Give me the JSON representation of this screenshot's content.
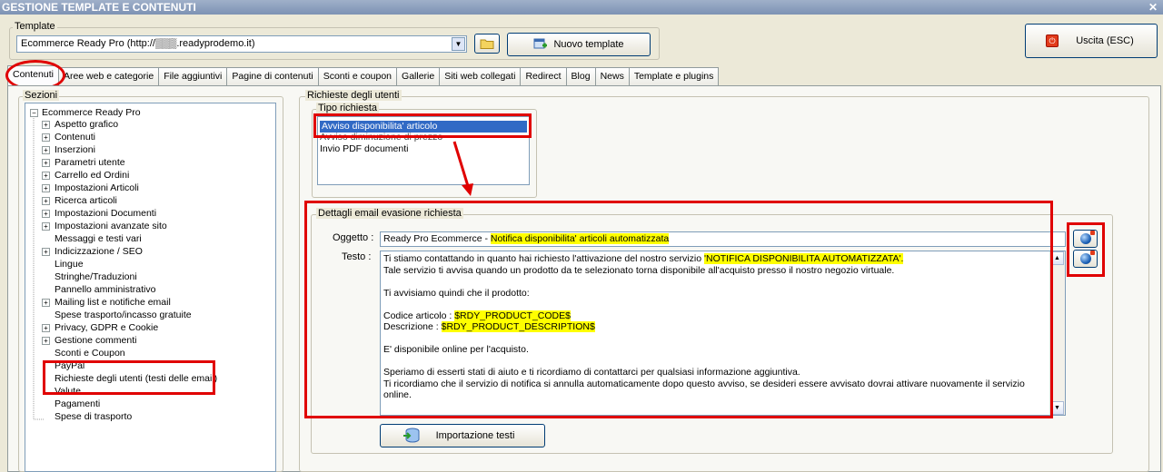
{
  "window": {
    "title": "GESTIONE TEMPLATE E CONTENUTI",
    "close": "✕"
  },
  "template": {
    "label": "Template",
    "selected": "Ecommerce Ready Pro (http://▒▒▒.readyprodemo.it)",
    "new_button": "Nuovo template"
  },
  "exit_button": "Uscita (ESC)",
  "tabs": [
    "Contenuti",
    "Aree web e categorie",
    "File aggiuntivi",
    "Pagine di contenuti",
    "Sconti e coupon",
    "Gallerie",
    "Siti web collegati",
    "Redirect",
    "Blog",
    "News",
    "Template e plugins"
  ],
  "sections": {
    "label": "Sezioni",
    "root": "Ecommerce Ready Pro",
    "items": [
      "Aspetto grafico",
      "Contenuti",
      "Inserzioni",
      "Parametri utente",
      "Carrello ed Ordini",
      "Impostazioni Articoli",
      "Ricerca articoli",
      "Impostazioni Documenti",
      "Impostazioni avanzate sito",
      "Messaggi e testi vari",
      "Indicizzazione / SEO",
      "Lingue",
      "Stringhe/Traduzioni",
      "Pannello amministrativo",
      "Mailing list e notifiche email",
      "Spese trasporto/incasso gratuite",
      "Privacy, GDPR e Cookie",
      "Gestione commenti",
      "Sconti e Coupon",
      "PayPal",
      "Richieste degli utenti (testi delle email)",
      "Valute",
      "Pagamenti",
      "Spese di trasporto"
    ]
  },
  "requests": {
    "label": "Richieste degli utenti",
    "type_label": "Tipo richiesta",
    "types": [
      "Avviso disponibilita' articolo",
      "Avviso diminuzione di prezzo",
      "Invio PDF documenti"
    ]
  },
  "details": {
    "label": "Dettagli email evasione richiesta",
    "subject_label": "Oggetto :",
    "subject_prefix": "Ready Pro Ecommerce - ",
    "subject_highlight": "Notifica disponibilita' articoli automatizzata",
    "text_label": "Testo :",
    "body": {
      "l1_pre": "Ti stiamo contattando in quanto hai richiesto l'attivazione del nostro servizio ",
      "l1_hl": "'NOTIFICA DISPONIBILITA AUTOMATIZZATA'.",
      "l2": "Tale servizio ti avvisa quando un prodotto da te selezionato torna disponibile all'acquisto presso il nostro negozio virtuale.",
      "l3": "Ti avvisiamo quindi che il prodotto:",
      "l4_pre": "Codice articolo : ",
      "l4_hl": "$RDY_PRODUCT_CODE$",
      "l5_pre": "Descrizione : ",
      "l5_hl": "$RDY_PRODUCT_DESCRIPTION$",
      "l6": "E' disponibile online per l'acquisto.",
      "l7": "Speriamo di esserti stati di aiuto e ti ricordiamo di contattarci per qualsiasi informazione aggiuntiva.",
      "l8": "Ti ricordiamo che il servizio di notifica si annulla automaticamente dopo questo avviso, se desideri essere avvisato dovrai attivare nuovamente il servizio online."
    },
    "import_button": "Importazione testi"
  },
  "colors": {
    "highlight": "#ffff00",
    "annotation": "#e00000",
    "selection": "#316ac5"
  }
}
